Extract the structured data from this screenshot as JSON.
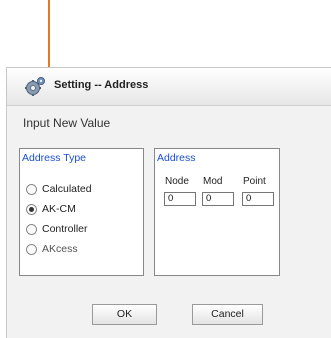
{
  "window": {
    "title": "Setting -- Address",
    "icon": "gear-icon"
  },
  "prompt": "Input New Value",
  "address_type": {
    "title": "Address Type",
    "options": [
      {
        "label": "Calculated",
        "selected": false
      },
      {
        "label": "AK-CM",
        "selected": true
      },
      {
        "label": "Controller",
        "selected": false
      },
      {
        "label": "AKcess",
        "selected": false
      }
    ]
  },
  "address": {
    "title": "Address",
    "columns": [
      "Node",
      "Mod",
      "Point"
    ],
    "values": [
      "0",
      "0",
      "0"
    ]
  },
  "buttons": {
    "ok": "OK",
    "cancel": "Cancel"
  },
  "colors": {
    "accent_line": "#e07a25",
    "group_title": "#1a4fd6"
  }
}
